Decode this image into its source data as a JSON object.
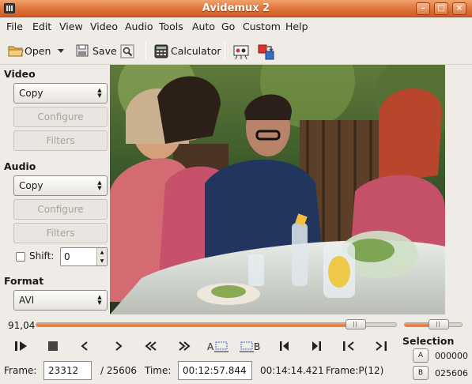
{
  "window": {
    "title": "Avidemux 2"
  },
  "menu": [
    "File",
    "Edit",
    "View",
    "Video",
    "Audio",
    "Tools",
    "Auto",
    "Go",
    "Custom",
    "Help"
  ],
  "toolbar": {
    "open_label": "Open",
    "save_label": "Save",
    "calculator_label": "Calculator"
  },
  "video": {
    "section_label": "Video",
    "codec_value": "Copy",
    "configure_label": "Configure",
    "filters_label": "Filters"
  },
  "audio": {
    "section_label": "Audio",
    "codec_value": "Copy",
    "configure_label": "Configure",
    "filters_label": "Filters",
    "shift_label": "Shift:",
    "shift_value": "0"
  },
  "format": {
    "section_label": "Format",
    "value": "AVI"
  },
  "seek": {
    "position_label": "91,04",
    "position_fraction": 0.91,
    "volume_fraction": 0.65
  },
  "selection": {
    "title": "Selection",
    "a_label": "A",
    "a_value": "000000",
    "b_label": "B",
    "b_value": "025606"
  },
  "status": {
    "frame_label": "Frame:",
    "frame_value": "23312",
    "total_frames": "/ 25606",
    "time_label": "Time:",
    "time_value": "00:12:57.844",
    "total_time": "00:14:14.421",
    "frame_type": "Frame:P(12)"
  },
  "colors": {
    "accent": "#e0713a",
    "titlebar": "#d9652d"
  }
}
